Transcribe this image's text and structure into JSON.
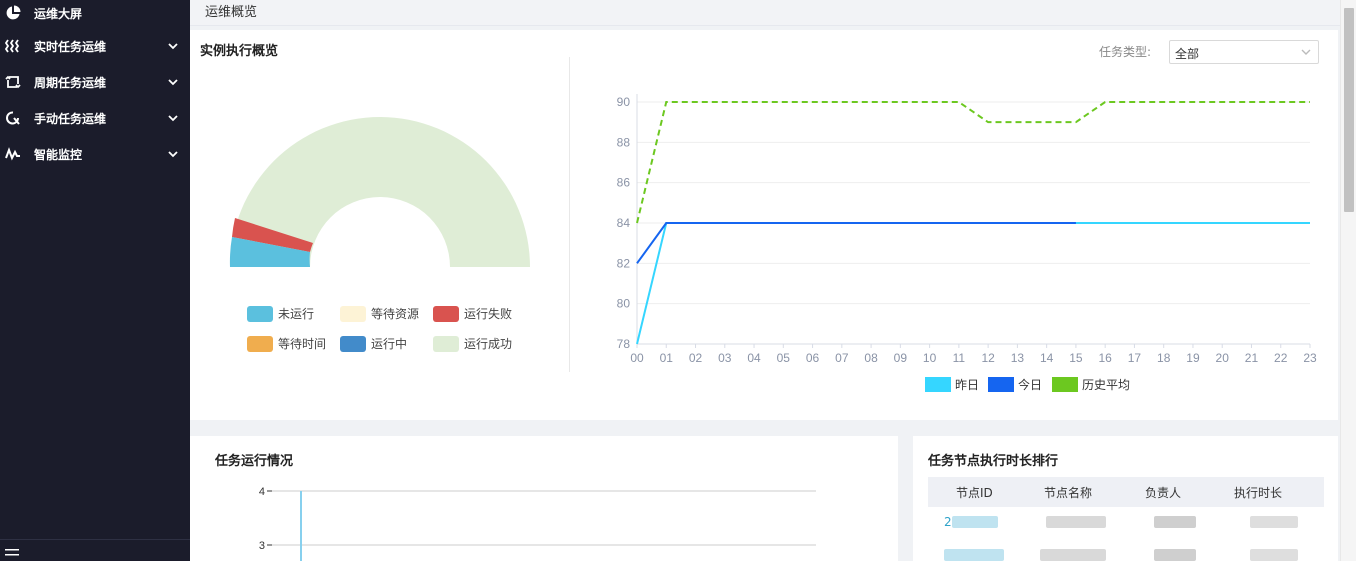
{
  "sidebar": {
    "items": [
      {
        "label": "运维大屏",
        "icon": "pie-chart-icon"
      },
      {
        "label": "实时任务运维",
        "icon": "stream-icon"
      },
      {
        "label": "周期任务运维",
        "icon": "cycle-icon"
      },
      {
        "label": "手动任务运维",
        "icon": "manual-icon"
      },
      {
        "label": "智能监控",
        "icon": "monitor-wave-icon"
      }
    ],
    "footer_icon": "menu-collapse-icon"
  },
  "breadcrumb": "运维概览",
  "overview": {
    "title": "实例执行概览",
    "filter_label": "任务类型:",
    "filter_value": "全部",
    "donut_legend": [
      {
        "label": "未运行",
        "color": "#5bc0de"
      },
      {
        "label": "等待资源",
        "color": "#fdf3d6"
      },
      {
        "label": "运行失败",
        "color": "#d9534f"
      },
      {
        "label": "等待时间",
        "color": "#f0ad4e"
      },
      {
        "label": "运行中",
        "color": "#428bca"
      },
      {
        "label": "运行成功",
        "color": "#dfedd6"
      }
    ]
  },
  "chart_data": {
    "type": "line",
    "x": [
      "00",
      "01",
      "02",
      "03",
      "04",
      "05",
      "06",
      "07",
      "08",
      "09",
      "10",
      "11",
      "12",
      "13",
      "14",
      "15",
      "16",
      "17",
      "18",
      "19",
      "20",
      "21",
      "22",
      "23"
    ],
    "ylim": [
      78,
      90
    ],
    "yticks": [
      "78",
      "80",
      "82",
      "84",
      "86",
      "88",
      "90"
    ],
    "series": [
      {
        "name": "昨日",
        "color": "#35d6ff",
        "style": "solid",
        "values": [
          78,
          84,
          84,
          84,
          84,
          84,
          84,
          84,
          84,
          84,
          84,
          84,
          84,
          84,
          84,
          84,
          84,
          84,
          84,
          84,
          84,
          84,
          84,
          84
        ]
      },
      {
        "name": "今日",
        "color": "#1565f0",
        "style": "solid",
        "values": [
          82,
          84,
          84,
          84,
          84,
          84,
          84,
          84,
          84,
          84,
          84,
          84,
          84,
          84,
          84,
          84
        ]
      },
      {
        "name": "历史平均",
        "color": "#6cc820",
        "style": "dashed",
        "values": [
          84,
          90,
          90,
          90,
          90,
          90,
          90,
          90,
          90,
          90,
          90,
          90,
          89,
          89,
          89,
          89,
          90,
          90,
          90,
          90,
          90,
          90,
          90,
          90
        ]
      }
    ]
  },
  "run_panel": {
    "title": "任务运行情况",
    "yticks": [
      "4",
      "3"
    ]
  },
  "rank_panel": {
    "title": "任务节点执行时长排行",
    "columns": [
      "节点ID",
      "节点名称",
      "负责人",
      "执行时长"
    ],
    "first_id_prefix": "2"
  }
}
